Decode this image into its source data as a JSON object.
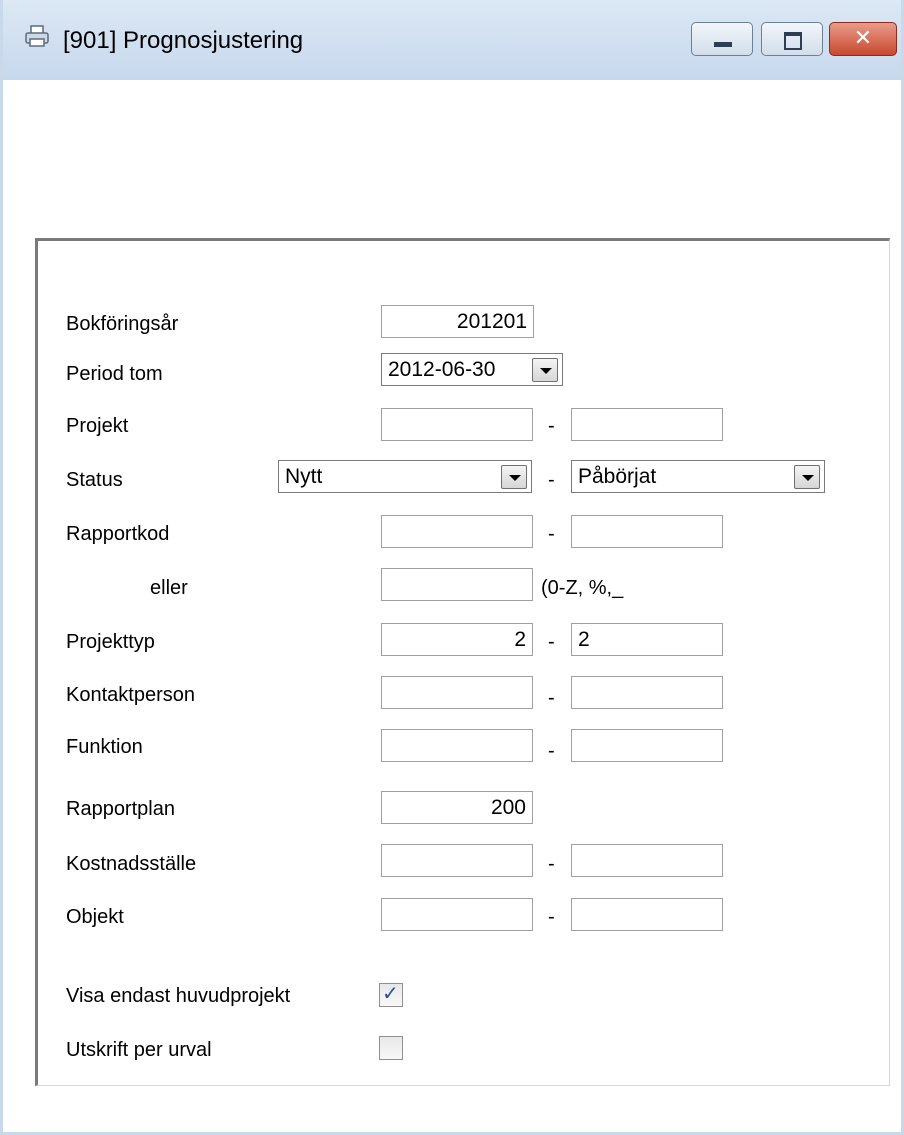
{
  "window": {
    "title": "[901]  Prognosjustering",
    "icon": "printer-icon",
    "close_glyph": "✕"
  },
  "form": {
    "bokforingsar": {
      "label": "Bokföringsår",
      "value": "201201"
    },
    "period_tom": {
      "label": "Period tom",
      "value": "2012-06-30"
    },
    "projekt": {
      "label": "Projekt",
      "from": "",
      "to": ""
    },
    "status": {
      "label": "Status",
      "from": "Nytt",
      "to": "Påbörjat"
    },
    "rapportkod": {
      "label": "Rapportkod",
      "from": "",
      "to": ""
    },
    "eller": {
      "label": "eller",
      "value": "",
      "hint": "(0-Z, %,_"
    },
    "projekttyp": {
      "label": "Projekttyp",
      "from": "2",
      "to": "2"
    },
    "kontaktperson": {
      "label": "Kontaktperson",
      "from": "",
      "to": ""
    },
    "funktion": {
      "label": "Funktion",
      "from": "",
      "to": ""
    },
    "rapportplan": {
      "label": "Rapportplan",
      "value": "200"
    },
    "kostnadsstalle": {
      "label": "Kostnadsställe",
      "from": "",
      "to": ""
    },
    "objekt": {
      "label": "Objekt",
      "from": "",
      "to": ""
    },
    "visa_endast_huvudprojekt": {
      "label": "Visa endast huvudprojekt",
      "checked": true,
      "mark": "✓"
    },
    "utskrift_per_urval": {
      "label": "Utskrift per urval",
      "checked": false
    }
  },
  "separator": "-"
}
